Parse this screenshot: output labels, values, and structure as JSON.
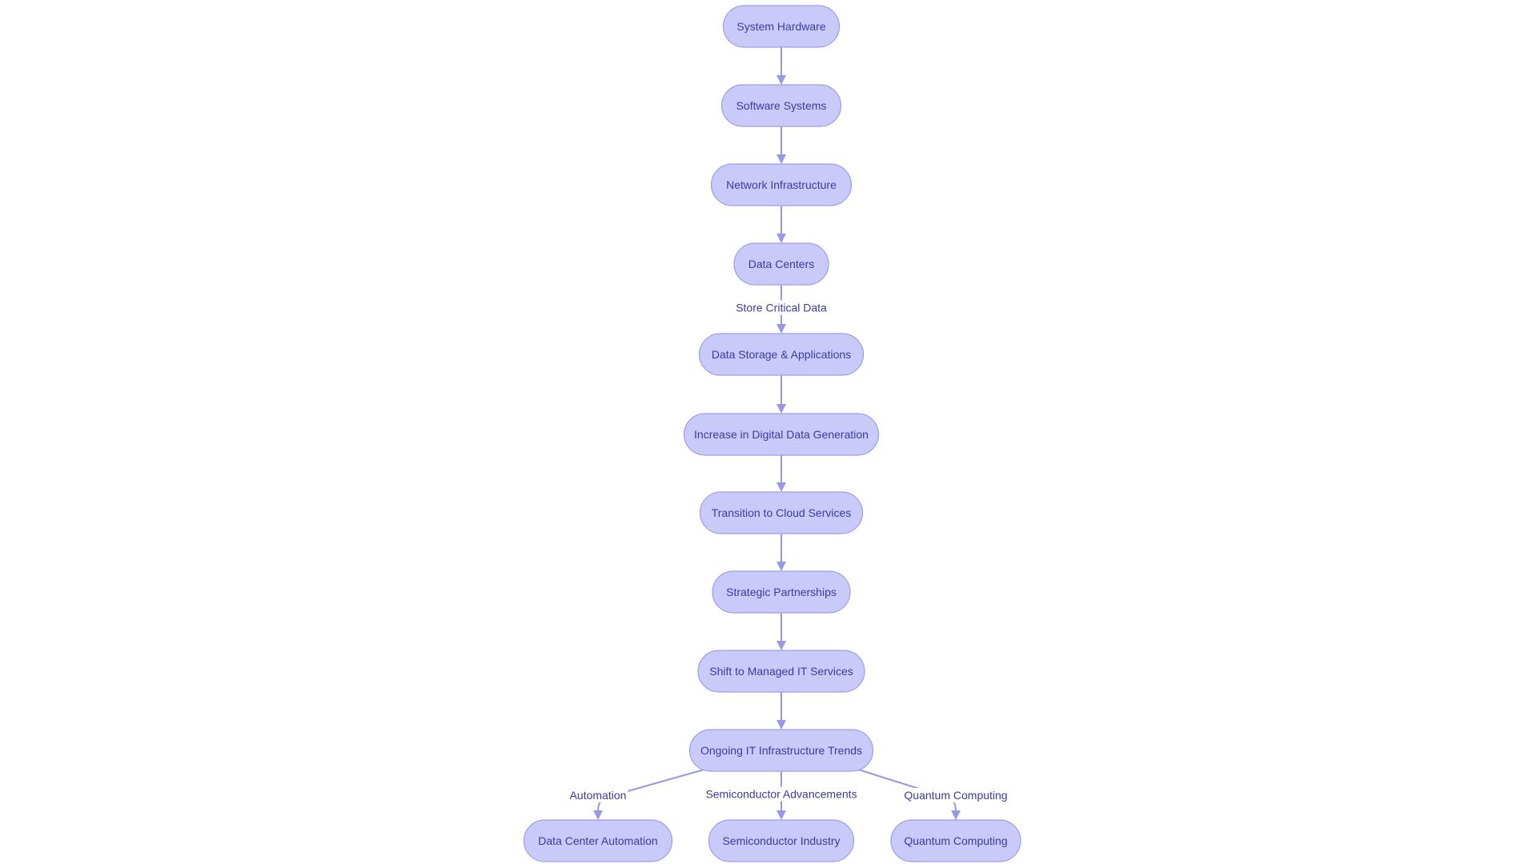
{
  "diagram": {
    "type": "flowchart",
    "direction": "top-to-bottom",
    "colors": {
      "node_fill": "#c9c9fa",
      "node_stroke": "#9d9dea",
      "text": "#3b3ba0",
      "edge": "#9898e6"
    },
    "nodes": [
      {
        "id": "hw",
        "label": "System Hardware"
      },
      {
        "id": "sw",
        "label": "Software Systems"
      },
      {
        "id": "net",
        "label": "Network Infrastructure"
      },
      {
        "id": "dc",
        "label": "Data Centers"
      },
      {
        "id": "dsa",
        "label": "Data Storage & Applications"
      },
      {
        "id": "inc",
        "label": "Increase in Digital Data Generation"
      },
      {
        "id": "cloud",
        "label": "Transition to Cloud Services"
      },
      {
        "id": "part",
        "label": "Strategic Partnerships"
      },
      {
        "id": "msp",
        "label": "Shift to Managed IT Services"
      },
      {
        "id": "trends",
        "label": "Ongoing IT Infrastructure Trends"
      },
      {
        "id": "dca",
        "label": "Data Center Automation"
      },
      {
        "id": "semi",
        "label": "Semiconductor Industry"
      },
      {
        "id": "qc",
        "label": "Quantum Computing"
      }
    ],
    "edges": [
      {
        "from": "hw",
        "to": "sw",
        "label": ""
      },
      {
        "from": "sw",
        "to": "net",
        "label": ""
      },
      {
        "from": "net",
        "to": "dc",
        "label": ""
      },
      {
        "from": "dc",
        "to": "dsa",
        "label": "Store Critical Data"
      },
      {
        "from": "dsa",
        "to": "inc",
        "label": ""
      },
      {
        "from": "inc",
        "to": "cloud",
        "label": ""
      },
      {
        "from": "cloud",
        "to": "part",
        "label": ""
      },
      {
        "from": "part",
        "to": "msp",
        "label": ""
      },
      {
        "from": "msp",
        "to": "trends",
        "label": ""
      },
      {
        "from": "trends",
        "to": "dca",
        "label": "Automation"
      },
      {
        "from": "trends",
        "to": "semi",
        "label": "Semiconductor Advancements"
      },
      {
        "from": "trends",
        "to": "qc",
        "label": "Quantum Computing"
      }
    ]
  }
}
